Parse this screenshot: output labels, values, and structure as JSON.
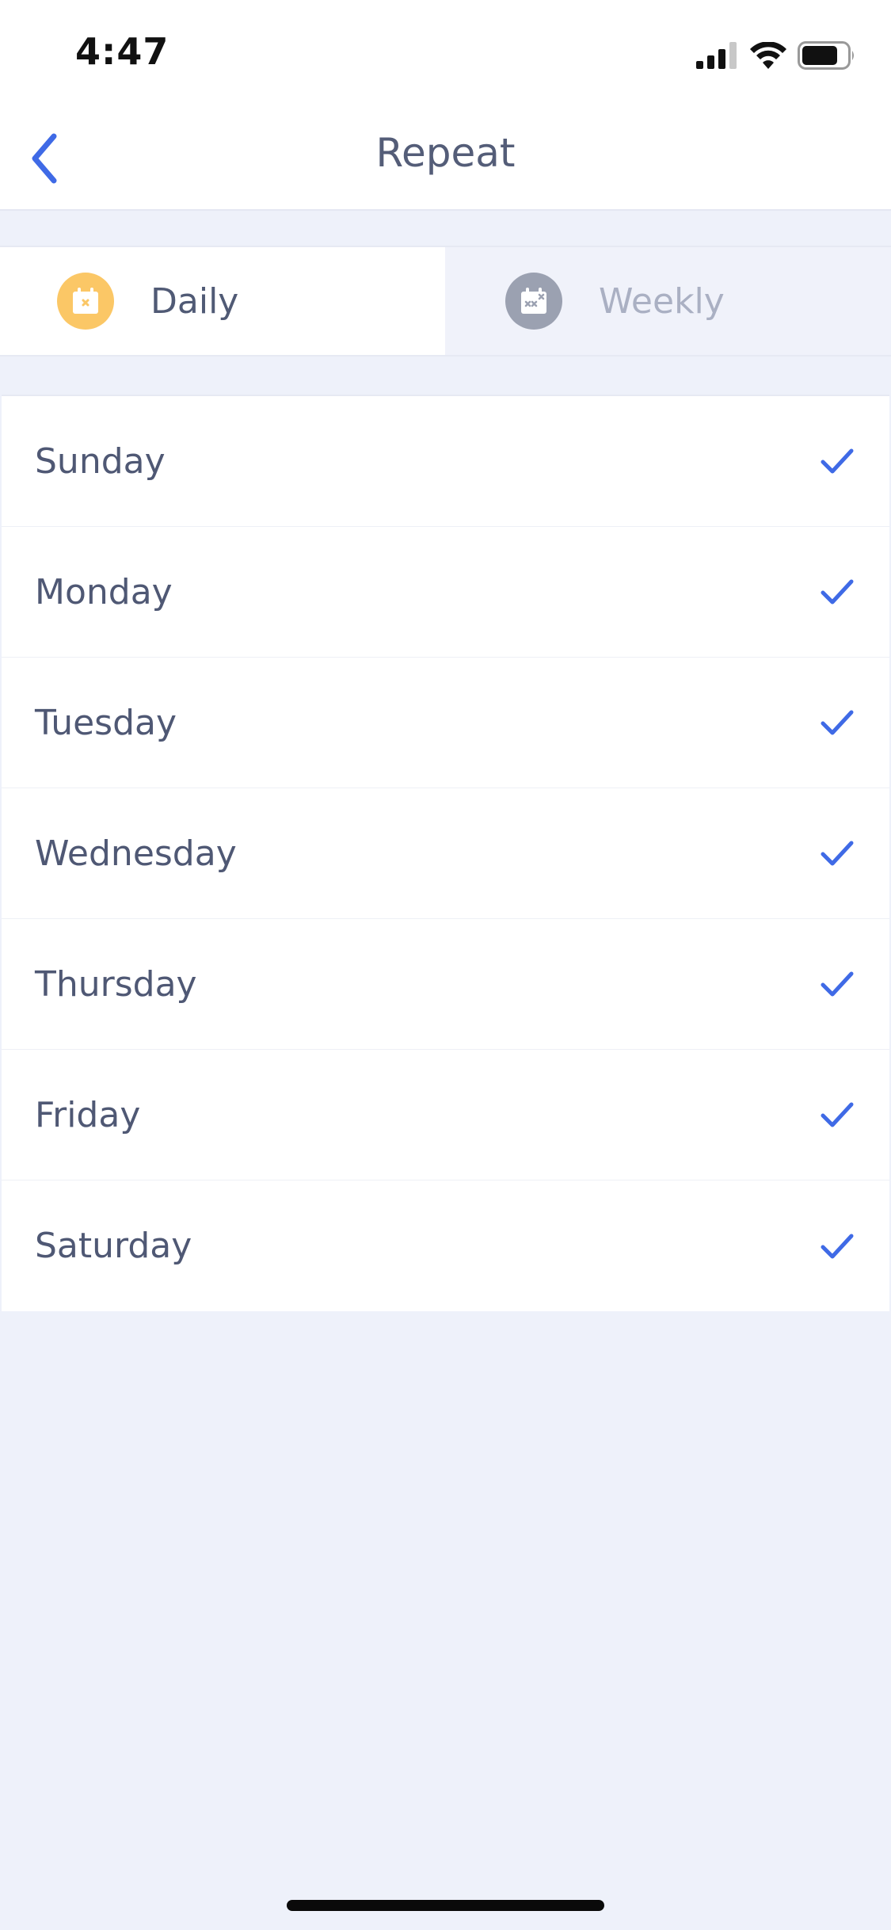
{
  "status_bar": {
    "time": "4:47"
  },
  "nav": {
    "title": "Repeat",
    "back_icon": "chevron-left-icon"
  },
  "segments": [
    {
      "label": "Daily",
      "icon": "calendar-icon",
      "active": true,
      "icon_color": "#fbc766"
    },
    {
      "label": "Weekly",
      "icon": "calendar-icon",
      "active": false,
      "icon_color": "#9ba1b1"
    }
  ],
  "days": [
    {
      "label": "Sunday",
      "checked": true
    },
    {
      "label": "Monday",
      "checked": true
    },
    {
      "label": "Tuesday",
      "checked": true
    },
    {
      "label": "Wednesday",
      "checked": true
    },
    {
      "label": "Thursday",
      "checked": true
    },
    {
      "label": "Friday",
      "checked": true
    },
    {
      "label": "Saturday",
      "checked": true
    }
  ],
  "colors": {
    "accent": "#3f6ae6",
    "text": "#4f5874",
    "background": "#eef1fa"
  }
}
